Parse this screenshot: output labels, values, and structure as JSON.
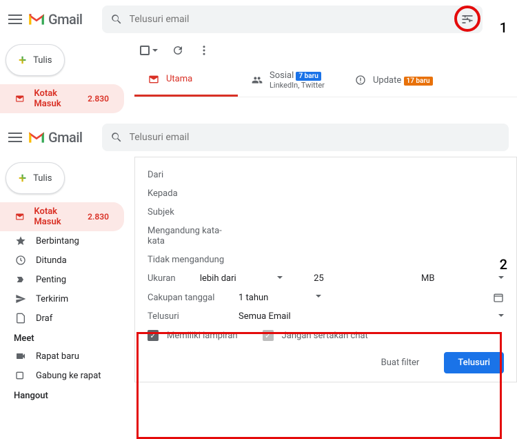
{
  "app": "Gmail",
  "step1": "1",
  "step2": "2",
  "search_placeholder": "Telusuri email",
  "compose": "Tulis",
  "inbox": {
    "label": "Kotak Masuk",
    "count": "2.830"
  },
  "toolbar_tabs": {
    "primary": "Utama",
    "social": "Sosial",
    "social_badge": "7 baru",
    "social_sub": "LinkedIn, Twitter",
    "updates": "Update",
    "updates_badge": "17 baru"
  },
  "nav": {
    "starred": "Berbintang",
    "snoozed": "Ditunda",
    "important": "Penting",
    "sent": "Terkirim",
    "drafts": "Draf"
  },
  "meet": {
    "header": "Meet",
    "new": "Rapat baru",
    "join": "Gabung ke rapat"
  },
  "hangout": "Hangout",
  "form": {
    "from": "Dari",
    "to": "Kepada",
    "subject": "Subjek",
    "has_words": "Mengandung kata-kata",
    "not_has": "Tidak mengandung",
    "size": "Ukuran",
    "size_op": "lebih dari",
    "size_val": "25",
    "size_unit": "MB",
    "date": "Cakupan tanggal",
    "date_val": "1 tahun",
    "searchin": "Telusuri",
    "searchin_val": "Semua Email",
    "attach": "Memiliki lampiran",
    "nochat": "Jangan sertakan chat",
    "filter_btn": "Buat filter",
    "search_btn": "Telusuri"
  }
}
